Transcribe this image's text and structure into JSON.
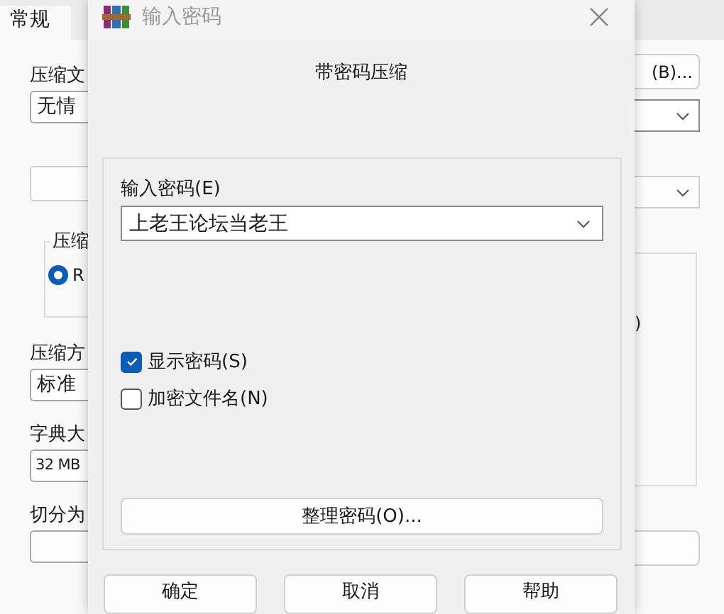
{
  "background_window": {
    "tab": "常规",
    "left": {
      "archive_label": "压缩文",
      "archive_name": "无情",
      "group_label": "压缩",
      "radio": {
        "label": "R",
        "selected": true
      },
      "method_label": "压缩方",
      "method": "标准",
      "dict_label": "字典大",
      "dict": "32 MB",
      "split_label": "切分为"
    },
    "right": {
      "browse_button": "(B)...",
      "group_text": ")"
    }
  },
  "dialog": {
    "title": "输入密码",
    "heading": "带密码压缩",
    "password_label": "输入密码(E)",
    "password": "上老王论坛当老王",
    "options": [
      {
        "label": "显示密码(S)",
        "checked": true
      },
      {
        "label": "加密文件名(N)",
        "checked": false
      }
    ],
    "organize_button": "整理密码(O)...",
    "buttons": [
      "确定",
      "取消",
      "帮助"
    ]
  }
}
